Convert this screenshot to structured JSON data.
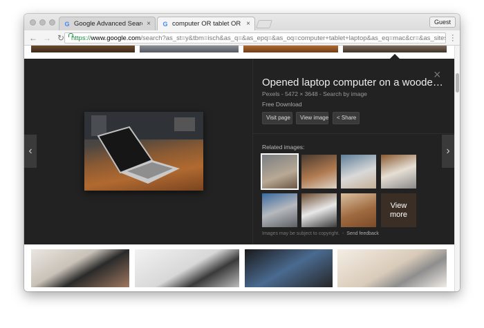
{
  "browser": {
    "tabs": [
      {
        "label": "Google Advanced Search",
        "icon": "google-g-icon",
        "active": false
      },
      {
        "label": "computer OR tablet OR laptop",
        "icon": "google-g-icon",
        "active": true
      }
    ],
    "guest_label": "Guest",
    "url": {
      "scheme": "https://",
      "domain": "www.google.com",
      "path": "/search?as_st=y&tbm=isch&as_q=&as_epq=&as_oq=computer+tablet+laptop&as_eq=mac&cr=&as_sitese…"
    }
  },
  "image_panel": {
    "title": "Opened laptop computer on a woode…",
    "meta": "Pexels  -  5472 × 3648  -  Search by image",
    "free_download": "Free Download",
    "buttons": {
      "visit_page": "Visit page",
      "view_image": "View image",
      "share": "Share"
    },
    "related_label": "Related images:",
    "view_more": "View more",
    "disclaimer_text": "Images may be subject to copyright.",
    "send_feedback": "Send feedback"
  },
  "icons": {
    "close": "×",
    "prev": "‹",
    "next": "›",
    "share": "share-icon"
  },
  "colors": {
    "panel_bg": "#222222",
    "secure_green": "#1e8e3e"
  }
}
